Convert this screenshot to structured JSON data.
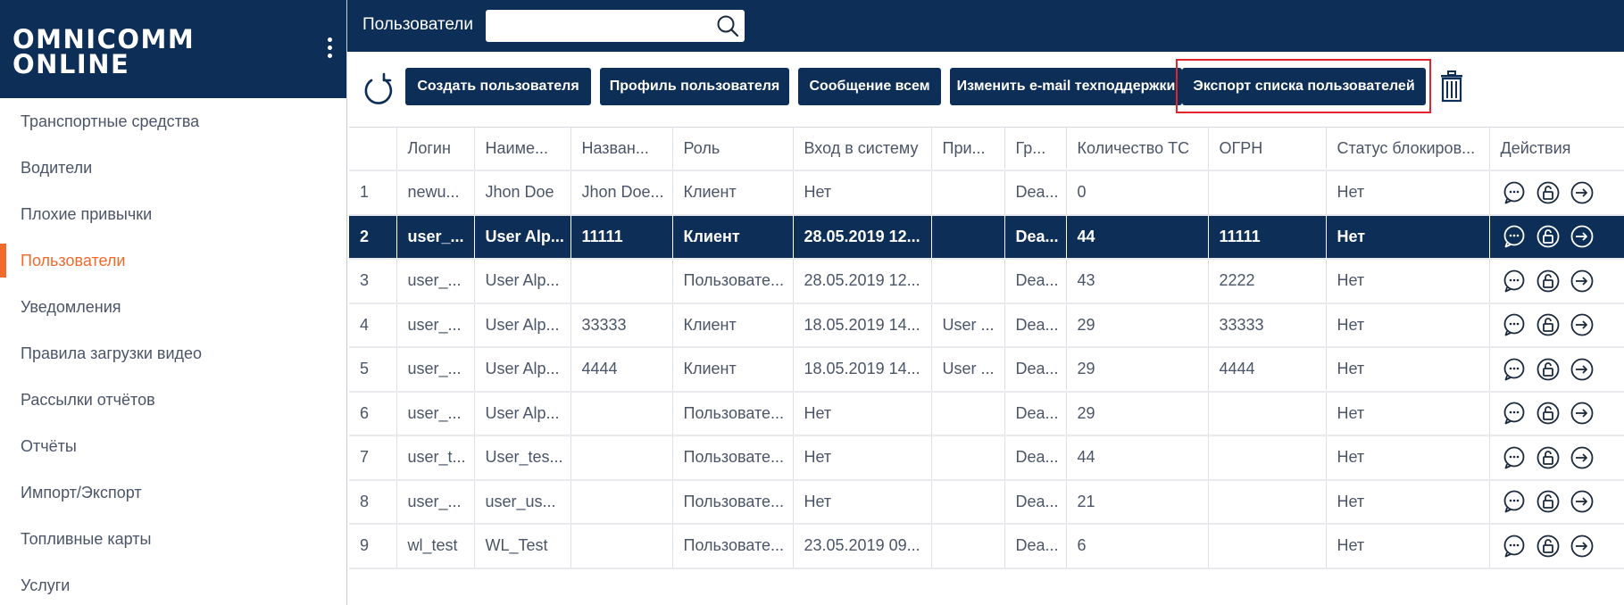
{
  "app": {
    "logo_line1": "OMNICOMM",
    "logo_line2": "ONLINE"
  },
  "sidebar": {
    "items": [
      {
        "label": "Транспортные средства"
      },
      {
        "label": "Водители"
      },
      {
        "label": "Плохие привычки"
      },
      {
        "label": "Пользователи",
        "active": true
      },
      {
        "label": "Уведомления"
      },
      {
        "label": "Правила загрузки видео"
      },
      {
        "label": "Рассылки отчётов"
      },
      {
        "label": "Отчёты"
      },
      {
        "label": "Импорт/Экспорт"
      },
      {
        "label": "Топливные карты"
      },
      {
        "label": "Услуги"
      }
    ]
  },
  "topbar": {
    "title": "Пользователи",
    "search_value": ""
  },
  "toolbar": {
    "create_label": "Создать пользователя",
    "profile_label": "Профиль пользователя",
    "message_label": "Сообщение всем",
    "email_label": "Изменить e-mail техподдержки",
    "export_label": "Экспорт списка пользователей"
  },
  "table": {
    "headers": [
      "",
      "Логин",
      "Наиме...",
      "Назван...",
      "Роль",
      "Вход в систему",
      "При...",
      "Гр...",
      "Количество ТС",
      "ОГРН",
      "Статус блокиров...",
      "Действия"
    ],
    "rows": [
      [
        "1",
        "newu...",
        "Jhon Doe",
        "Jhon Doe...",
        "Клиент",
        "Нет",
        "",
        "Dea...",
        "0",
        "",
        "Нет"
      ],
      [
        "2",
        "user_...",
        "User Alp...",
        "11111",
        "Клиент",
        "28.05.2019 12...",
        "",
        "Dea...",
        "44",
        "11111",
        "Нет"
      ],
      [
        "3",
        "user_...",
        "User Alp...",
        "",
        "Пользовате...",
        "28.05.2019 12...",
        "",
        "Dea...",
        "43",
        "2222",
        "Нет"
      ],
      [
        "4",
        "user_...",
        "User Alp...",
        "33333",
        "Клиент",
        "18.05.2019 14...",
        "User ...",
        "Dea...",
        "29",
        "33333",
        "Нет"
      ],
      [
        "5",
        "user_...",
        "User Alp...",
        "4444",
        "Клиент",
        "18.05.2019 14...",
        "User ...",
        "Dea...",
        "29",
        "4444",
        "Нет"
      ],
      [
        "6",
        "user_...",
        "User Alp...",
        "",
        "Пользовате...",
        "Нет",
        "",
        "Dea...",
        "29",
        "",
        "Нет"
      ],
      [
        "7",
        "user_t...",
        "User_tes...",
        "",
        "Пользовате...",
        "Нет",
        "",
        "Dea...",
        "44",
        "",
        "Нет"
      ],
      [
        "8",
        "user_...",
        "user_us...",
        "",
        "Пользовате...",
        "Нет",
        "",
        "Dea...",
        "21",
        "",
        "Нет"
      ],
      [
        "9",
        "wl_test",
        "WL_Test",
        "",
        "Пользовате...",
        "23.05.2019 09...",
        "",
        "Dea...",
        "6",
        "",
        "Нет"
      ]
    ],
    "selected_row": 1,
    "row_action_icons": [
      "message-icon",
      "unlock-icon",
      "login-icon"
    ]
  },
  "colors": {
    "brand": "#0c2e57",
    "accent": "#f26a2b",
    "highlight": "#e3242b"
  }
}
